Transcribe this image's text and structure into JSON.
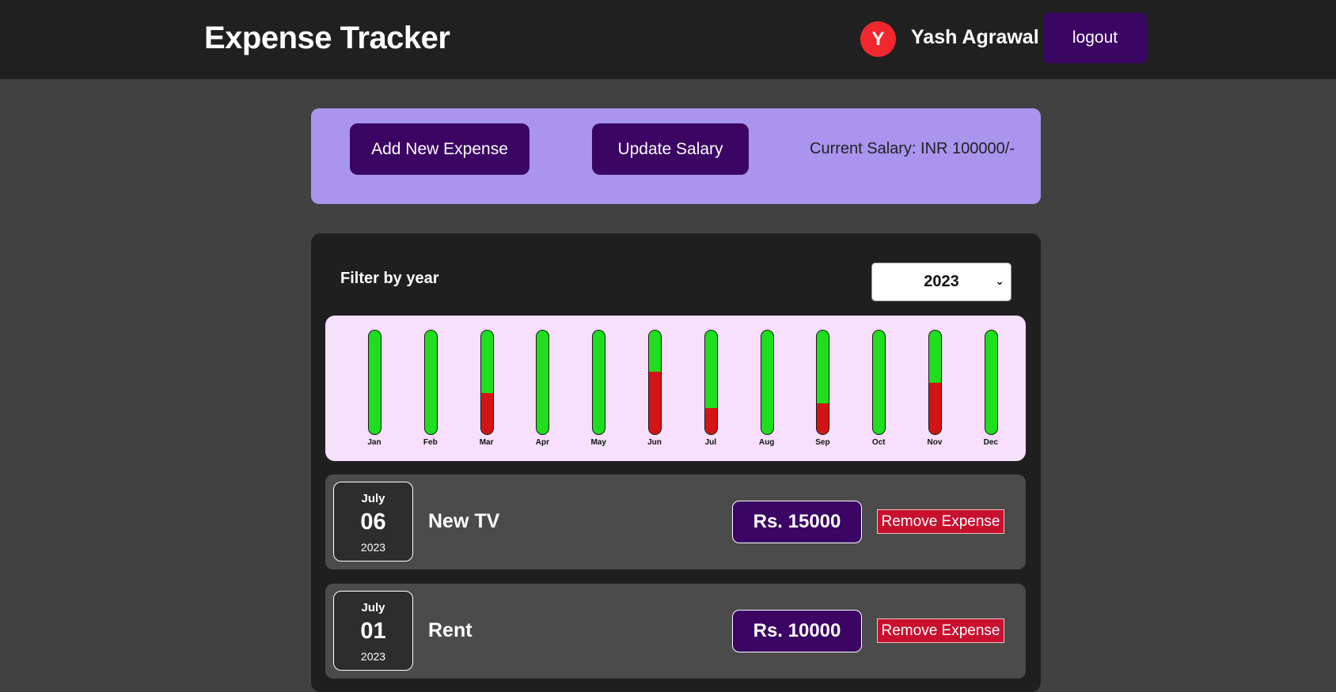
{
  "header": {
    "title": "Expense Tracker",
    "avatar_initial": "Y",
    "user_name": "Yash Agrawal",
    "logout_label": "logout"
  },
  "actions": {
    "add_expense_label": "Add New Expense",
    "update_salary_label": "Update Salary",
    "salary_text": "Current Salary: INR 100000/-"
  },
  "filter": {
    "label": "Filter by year",
    "selected_year": "2023"
  },
  "chart_data": {
    "type": "bar",
    "categories": [
      "Jan",
      "Feb",
      "Mar",
      "Apr",
      "May",
      "Jun",
      "Jul",
      "Aug",
      "Sep",
      "Oct",
      "Nov",
      "Dec"
    ],
    "fill_fraction": [
      0,
      0,
      0.4,
      0,
      0,
      0.6,
      0.25,
      0,
      0.3,
      0,
      0.5,
      0
    ],
    "colors": {
      "track": "#1ede1e",
      "fill": "#d41414"
    }
  },
  "expenses": [
    {
      "month": "July",
      "day": "06",
      "year": "2023",
      "title": "New TV",
      "amount": "Rs. 15000",
      "remove_label": "Remove Expense"
    },
    {
      "month": "July",
      "day": "01",
      "year": "2023",
      "title": "Rent",
      "amount": "Rs. 10000",
      "remove_label": "Remove Expense"
    }
  ],
  "colors": {
    "header_bg": "#202020",
    "page_bg": "#414141",
    "accent_purple": "#3a0563",
    "panel_lavender": "#a994ee",
    "chart_bg": "#f7dffd",
    "remove_red": "#c8102e",
    "avatar_red": "#f0282d"
  },
  "icons": {
    "select_chevron": "chevron-down-icon"
  }
}
